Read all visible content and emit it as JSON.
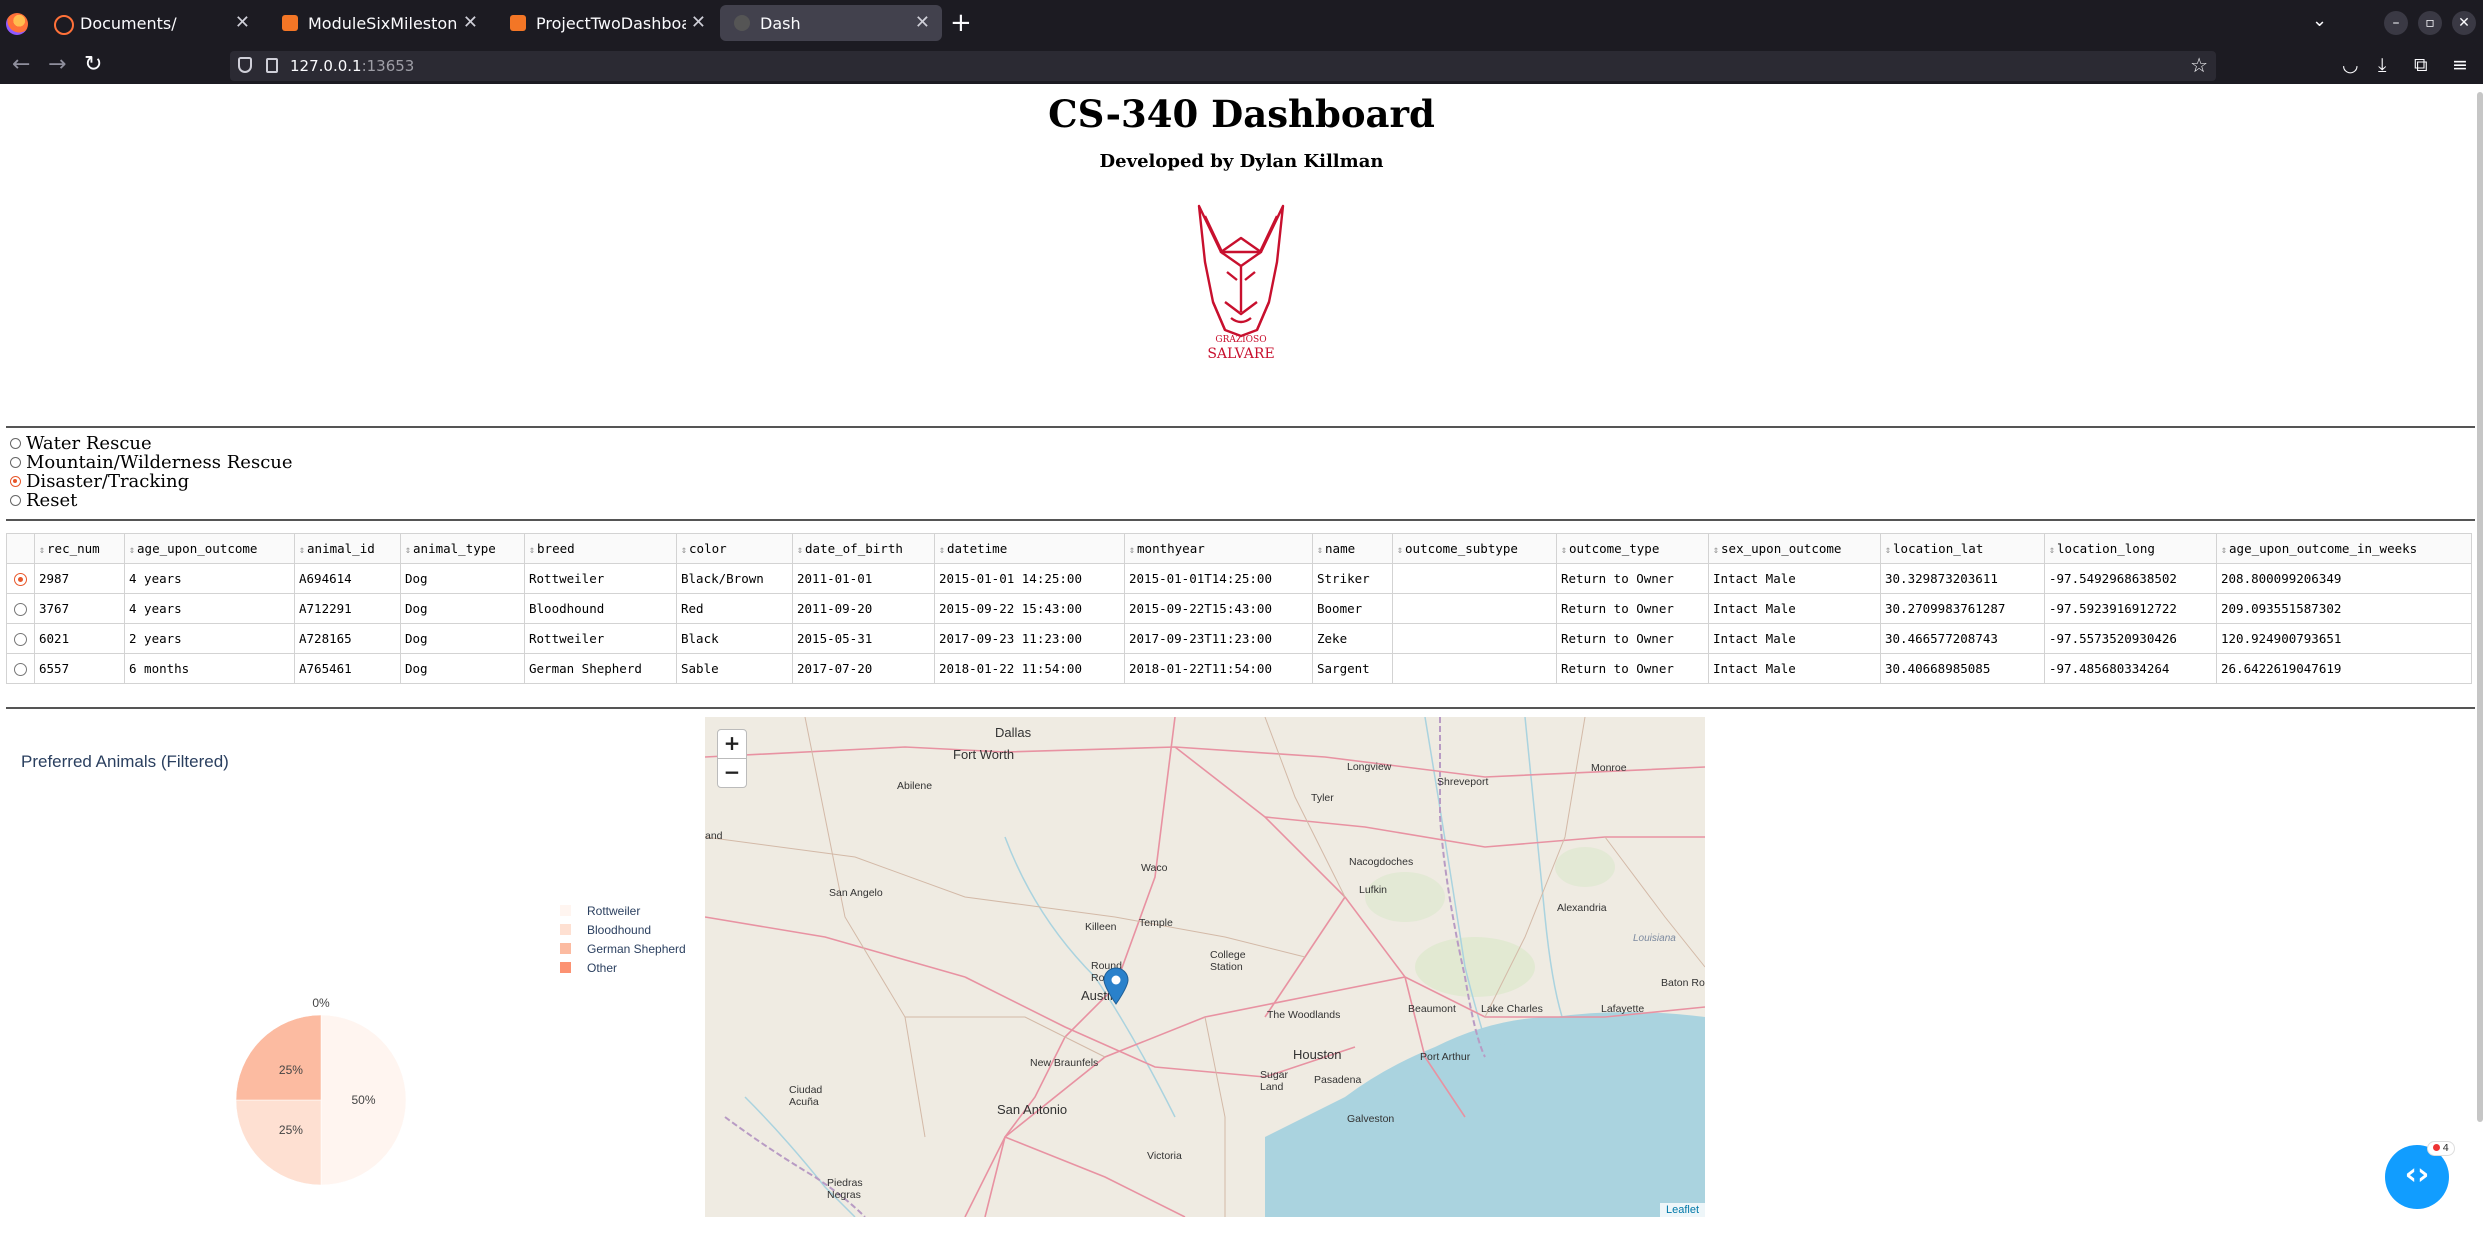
{
  "browser": {
    "tabs": [
      {
        "label": "Documents/",
        "active": false
      },
      {
        "label": "ModuleSixMilestone-Tem",
        "active": false
      },
      {
        "label": "ProjectTwoDashboard - J",
        "active": false
      },
      {
        "label": "Dash",
        "active": true
      }
    ],
    "url_host": "127.0.0.1",
    "url_port": ":13653"
  },
  "page": {
    "title": "CS-340 Dashboard",
    "subtitle": "Developed by Dylan Killman",
    "logo_text_top": "GRAZIOSO",
    "logo_text_bottom": "SALVARE"
  },
  "filters": {
    "options": [
      "Water Rescue",
      "Mountain/Wilderness Rescue",
      "Disaster/Tracking",
      "Reset"
    ],
    "selected": "Disaster/Tracking"
  },
  "table": {
    "columns": [
      "rec_num",
      "age_upon_outcome",
      "animal_id",
      "animal_type",
      "breed",
      "color",
      "date_of_birth",
      "datetime",
      "monthyear",
      "name",
      "outcome_subtype",
      "outcome_type",
      "sex_upon_outcome",
      "location_lat",
      "location_long",
      "age_upon_outcome_in_weeks"
    ],
    "selected_row": 0,
    "rows": [
      [
        "2987",
        "4 years",
        "A694614",
        "Dog",
        "Rottweiler",
        "Black/Brown",
        "2011-01-01",
        "2015-01-01 14:25:00",
        "2015-01-01T14:25:00",
        "Striker",
        "",
        "Return to Owner",
        "Intact Male",
        "30.329873203611",
        "-97.5492968638502",
        "208.800099206349"
      ],
      [
        "3767",
        "4 years",
        "A712291",
        "Dog",
        "Bloodhound",
        "Red",
        "2011-09-20",
        "2015-09-22 15:43:00",
        "2015-09-22T15:43:00",
        "Boomer",
        "",
        "Return to Owner",
        "Intact Male",
        "30.2709983761287",
        "-97.5923916912722",
        "209.093551587302"
      ],
      [
        "6021",
        "2 years",
        "A728165",
        "Dog",
        "Rottweiler",
        "Black",
        "2015-05-31",
        "2017-09-23 11:23:00",
        "2017-09-23T11:23:00",
        "Zeke",
        "",
        "Return to Owner",
        "Intact Male",
        "30.466577208743",
        "-97.5573520930426",
        "120.924900793651"
      ],
      [
        "6557",
        "6 months",
        "A765461",
        "Dog",
        "German Shepherd",
        "Sable",
        "2017-07-20",
        "2018-01-22 11:54:00",
        "2018-01-22T11:54:00",
        "Sargent",
        "",
        "Return to Owner",
        "Intact Male",
        "30.40668985085",
        "-97.485680334264",
        "26.6422619047619"
      ]
    ]
  },
  "chart_data": {
    "type": "pie",
    "title": "Preferred Animals (Filtered)",
    "categories": [
      "Rottweiler",
      "Bloodhound",
      "German Shepherd",
      "Other"
    ],
    "values": [
      50,
      25,
      25,
      0
    ],
    "labels": [
      "50%",
      "25%",
      "25%",
      "0%"
    ],
    "colors": [
      "#fff5f0",
      "#fee0d2",
      "#fcbba1",
      "#fc9272"
    ],
    "legend_position": "right"
  },
  "map": {
    "zoom_in": "+",
    "zoom_out": "−",
    "attribution": "Leaflet",
    "cities": [
      "Dallas",
      "Fort Worth",
      "Abilene",
      "Longview",
      "Shreveport",
      "Monroe",
      "Tyler",
      "Waco",
      "Nacogdoches",
      "San Angelo",
      "Lufkin",
      "Alexandria",
      "Killeen",
      "Temple",
      "Louisiana",
      "College Station",
      "Round Rock",
      "Austin",
      "Baton Ro",
      "The Woodlands",
      "Beaumont",
      "Lake Charles",
      "Lafayette",
      "New Braunfels",
      "Houston",
      "Port Arthur",
      "Sugar Land",
      "Pasadena",
      "Ciudad Acuña",
      "San Antonio",
      "Galveston",
      "Victoria",
      "Piedras Negras",
      "and"
    ],
    "marker": {
      "lat": 30.40668985085,
      "long": -97.485680334264
    }
  },
  "fab": {
    "badge": "4"
  }
}
